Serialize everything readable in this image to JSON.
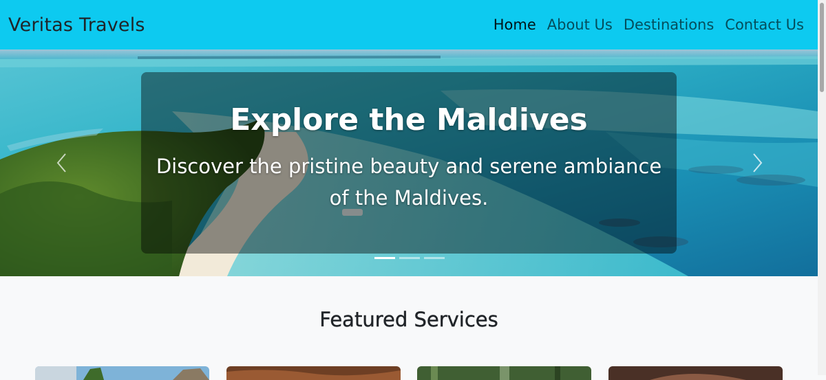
{
  "navbar": {
    "brand": "Veritas Travels",
    "links": [
      {
        "label": "Home",
        "active": true
      },
      {
        "label": "About Us",
        "active": false
      },
      {
        "label": "Destinations",
        "active": false
      },
      {
        "label": "Contact Us",
        "active": false
      }
    ],
    "background": "#0dcaf0"
  },
  "carousel": {
    "title": "Explore the Maldives",
    "text": "Discover the pristine beauty and serene ambiance of the Maldives.",
    "prev_icon": "chevron-left-icon",
    "next_icon": "chevron-right-icon",
    "indicators": [
      true,
      false,
      false
    ]
  },
  "featured": {
    "heading": "Featured Services",
    "cards": [
      {
        "image": "beach-palms-image",
        "tone": "#6a9fc9"
      },
      {
        "image": "desert-canyon-image",
        "tone": "#7a4a2e"
      },
      {
        "image": "forest-image",
        "tone": "#3c5a2f"
      },
      {
        "image": "spa-image",
        "tone": "#5a3a2c"
      }
    ]
  }
}
